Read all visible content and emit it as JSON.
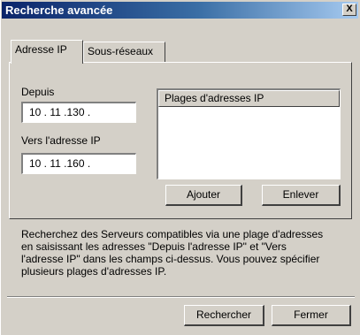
{
  "window": {
    "title": "Recherche avancée",
    "close_label": "X"
  },
  "tabs": [
    {
      "label": "Adresse IP",
      "active": true
    },
    {
      "label": "Sous-réseaux",
      "active": false
    }
  ],
  "from": {
    "label": "Depuis",
    "value": "10 . 11 .130 ."
  },
  "to": {
    "label": "Vers l'adresse IP",
    "value": "10 . 11 .160 ."
  },
  "ranges_list": {
    "header": "Plages d'adresses IP",
    "items": []
  },
  "buttons": {
    "add": "Ajouter",
    "remove": "Enlever",
    "search": "Rechercher",
    "close": "Fermer"
  },
  "description": {
    "lines": [
      "Recherchez des Serveurs compatibles via une plage d'adresses",
      "en saisissant les adresses \"Depuis l'adresse IP\" et \"Vers",
      "l'adresse IP\" dans les champs ci-dessus. Vous pouvez spécifier",
      "plusieurs plages d'adresses IP."
    ]
  },
  "colors": {
    "face": "#d4d0c8",
    "title_start": "#0a246a",
    "title_end": "#a6caf0"
  }
}
